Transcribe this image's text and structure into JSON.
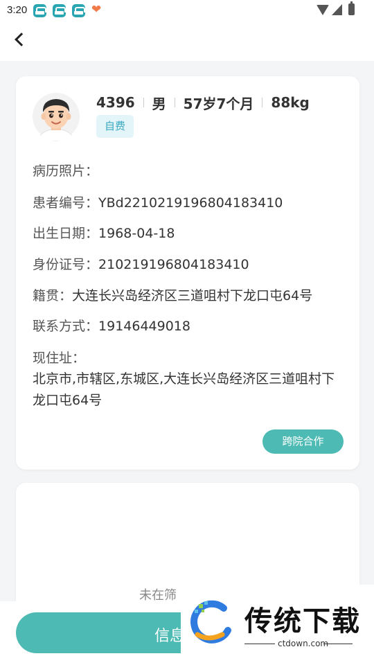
{
  "status_bar": {
    "time": "3:20",
    "app_icons": [
      "car-app-icon",
      "car-app-icon",
      "car-app-icon",
      "heart-app-icon"
    ]
  },
  "patient": {
    "name": "4396",
    "gender": "男",
    "age": "57岁7个月",
    "weight": "88kg",
    "payment_tag": "自费"
  },
  "details": {
    "medical_photos_label": "病历照片：",
    "patient_id_label": "患者编号：",
    "patient_id": "YBd2210219196804183410",
    "birth_date_label": "出生日期：",
    "birth_date": "1968-04-18",
    "id_card_label": "身份证号：",
    "id_card": "210219196804183410",
    "native_place_label": "籍贯：",
    "native_place": "大连长兴岛经济区三道咀村下龙口屯64号",
    "contact_label": "联系方式：",
    "contact": "19146449018",
    "address_label": "现住址：",
    "address": "北京市,市辖区,东城区,大连长兴岛经济区三道咀村下龙口屯64号"
  },
  "actions": {
    "cooperation_button": "跨院合作",
    "info_button": "信息"
  },
  "screening": {
    "message": "未在筛"
  },
  "watermark": {
    "title": "传统下载",
    "url": "ctdown.com"
  },
  "colors": {
    "accent": "#4dbab3",
    "tag_text": "#3aa9c1",
    "tag_bg": "#e4f5f9"
  }
}
